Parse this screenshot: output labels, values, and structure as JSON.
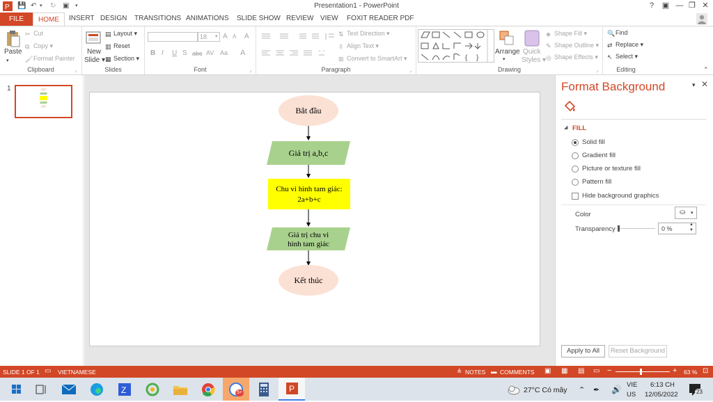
{
  "window": {
    "title": "Presentation1 - PowerPoint",
    "buttons": [
      "?",
      "▣",
      "—",
      "❐",
      "✕"
    ]
  },
  "user_icon": "user-avatar-icon",
  "tabs": [
    "FILE",
    "HOME",
    "INSERT",
    "DESIGN",
    "TRANSITIONS",
    "ANIMATIONS",
    "SLIDE SHOW",
    "REVIEW",
    "VIEW",
    "FOXIT READER PDF"
  ],
  "ribbon": {
    "clipboard": {
      "paste": "Paste",
      "cut": "Cut",
      "copy": "Copy",
      "format_painter": "Format Painter",
      "label": "Clipboard"
    },
    "slides": {
      "new_slide_1": "New",
      "new_slide_2": "Slide",
      "layout": "Layout",
      "reset": "Reset",
      "section": "Section",
      "label": "Slides"
    },
    "font": {
      "size": "18",
      "bold": "B",
      "italic": "I",
      "underline": "U",
      "strike": "S",
      "shadow": "abc",
      "spacing": "AV",
      "case": "Aa",
      "color": "A",
      "grow": "A",
      "shrink": "A",
      "clear": "A",
      "label": "Font"
    },
    "paragraph": {
      "text_direction": "Text Direction",
      "align_text": "Align Text",
      "smartart": "Convert to SmartArt",
      "label": "Paragraph"
    },
    "drawing": {
      "arrange": "Arrange",
      "quick_styles_1": "Quick",
      "quick_styles_2": "Styles",
      "shape_fill": "Shape Fill",
      "shape_outline": "Shape Outline",
      "shape_effects": "Shape Effects",
      "label": "Drawing"
    },
    "editing": {
      "find": "Find",
      "replace": "Replace",
      "select": "Select",
      "label": "Editing"
    }
  },
  "thumbs": {
    "slide_number": "1"
  },
  "slide": {
    "shapes": [
      {
        "kind": "ellipse",
        "text": "Bắt đầu"
      },
      {
        "kind": "parallelogram",
        "text": "Giá trị a,b,c"
      },
      {
        "kind": "rect",
        "text": "Chu vi hình tam giác:\n2a+b+c"
      },
      {
        "kind": "parallelogram",
        "text": "Giá trị chu vi\nhình tam giác"
      },
      {
        "kind": "ellipse",
        "text": "Kết thúc"
      }
    ],
    "colors": {
      "ellipse": "#fbe0d4",
      "parallelogram": "#a9d18e",
      "rect": "#ffff00"
    }
  },
  "format_pane": {
    "title": "Format Background",
    "section": "FILL",
    "options": [
      "Solid fill",
      "Gradient fill",
      "Picture or texture fill",
      "Pattern fill"
    ],
    "selected_option": "Solid fill",
    "hide_graphics": "Hide background graphics",
    "color_label": "Color",
    "transparency_label": "Transparency",
    "transparency_value": "0 %",
    "transparency_fraction": 0,
    "apply_all": "Apply to All",
    "reset": "Reset Background"
  },
  "status": {
    "slide": "SLIDE 1 OF 1",
    "language": "VIETNAMESE",
    "notes": "NOTES",
    "comments": "COMMENTS",
    "zoom": "63 %",
    "zoom_fraction": 0.45
  },
  "taskbar": {
    "weather": "27°C  Có mây",
    "lang_1": "VIE",
    "lang_2": "US",
    "time": "6:13 CH",
    "date": "12/05/2022",
    "notification_count": "23",
    "badge": "5+"
  },
  "colors": {
    "accent": "#d24726",
    "yellow": "#ffff00",
    "green": "#a9d18e",
    "peach": "#fbe0d4"
  }
}
